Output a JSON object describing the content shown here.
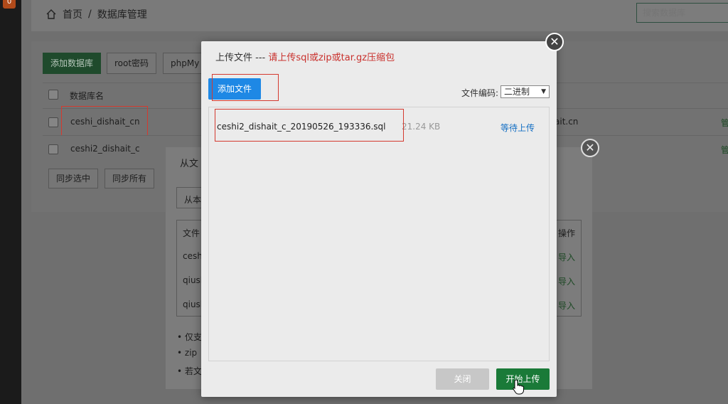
{
  "sidebar": {
    "badge": "0"
  },
  "breadcrumb": {
    "home": "首页",
    "separator": "/",
    "current": "数据库管理"
  },
  "search": {
    "placeholder": "搜索数据库"
  },
  "toolbar": {
    "add_db": "添加数据库",
    "root_password": "root密码",
    "phpmyadmin": "phpMy"
  },
  "table": {
    "header": "数据库名",
    "rows": [
      {
        "name": "ceshi_dishait_cn",
        "right_text": "ait.cn",
        "action": "管"
      },
      {
        "name": "ceshi2_dishait_c",
        "action": "管"
      }
    ]
  },
  "sync": {
    "selected": "同步选中",
    "all": "同步所有"
  },
  "back_modal": {
    "title": "从文",
    "source": "从本",
    "col_file": "文件",
    "col_action": "操作",
    "rows": [
      {
        "name": "cesh",
        "action": "导入"
      },
      {
        "name": "qiusl",
        "action": "导入"
      },
      {
        "name": "qiusl",
        "action": "导入"
      }
    ],
    "notes": [
      "仅支",
      "zip",
      "若文"
    ]
  },
  "upload_modal": {
    "title": "上传文件 --- ",
    "hint": "请上传sql或zip或tar.gz压缩包",
    "add_file": "添加文件",
    "encoding_label": "文件编码:",
    "encoding_value": "二进制",
    "file": {
      "name": "ceshi2_dishait_c_20190526_193336.sql",
      "size": "21.24 KB",
      "status": "等待上传"
    },
    "close": "关闭",
    "start": "开始上传"
  },
  "colors": {
    "primary_green": "#1a7a38",
    "blue_button": "#1e88e5",
    "hint_red": "#c9302c",
    "status_blue": "#1670c4"
  }
}
